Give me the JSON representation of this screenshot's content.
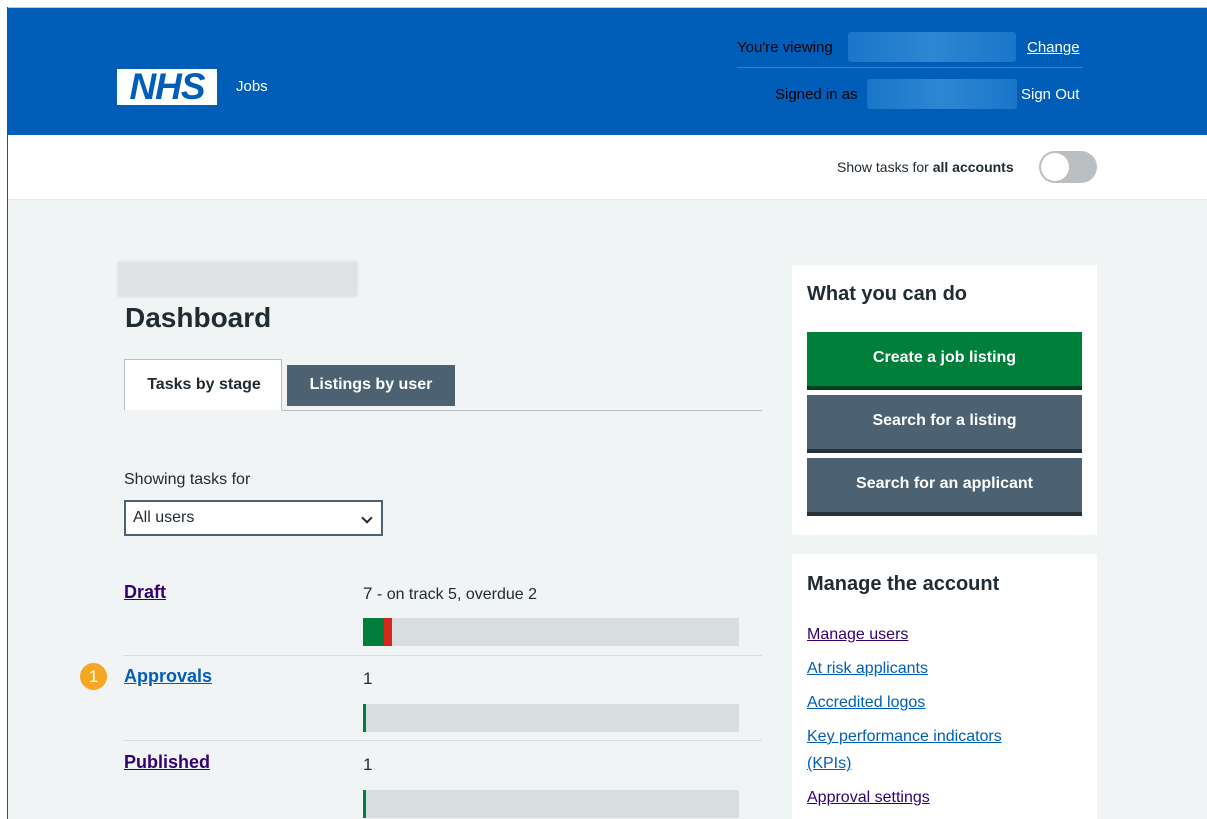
{
  "header": {
    "logo_text": "NHS",
    "service_name": "Jobs",
    "viewing_label": "You're viewing",
    "change_label": "Change",
    "signed_in_label": "Signed in as",
    "sign_out_label": "Sign Out",
    "brand_color": "#005eb8"
  },
  "toggle": {
    "label_prefix": "Show tasks for ",
    "label_bold": "all accounts",
    "state": "off"
  },
  "main": {
    "page_title": "Dashboard",
    "tabs": [
      {
        "label": "Tasks by stage",
        "active": true
      },
      {
        "label": "Listings by user",
        "active": false
      }
    ],
    "filter": {
      "label": "Showing tasks for",
      "selected": "All users"
    },
    "stages": [
      {
        "label": "Draft",
        "count": "7",
        "detail": " - on track 5, overdue 2",
        "on_track": 5,
        "overdue": 2,
        "total": 7
      },
      {
        "label": "Approvals",
        "count": "1",
        "detail": "",
        "on_track": 1,
        "overdue": 0,
        "total": 1
      },
      {
        "label": "Published",
        "count": "1",
        "detail": "",
        "on_track": 1,
        "overdue": 0,
        "total": 1
      }
    ],
    "step_badge": "1"
  },
  "sidebar": {
    "actions_title": "What you can do",
    "actions": [
      {
        "label": "Create a job listing",
        "style": "green"
      },
      {
        "label": "Search for a listing",
        "style": "grey"
      },
      {
        "label": "Search for an applicant",
        "style": "grey"
      }
    ],
    "manage_title": "Manage the account",
    "manage_links": [
      {
        "label": "Manage users"
      },
      {
        "label": "At risk applicants"
      },
      {
        "label": "Accredited logos"
      },
      {
        "label": "Key performance indicators"
      },
      {
        "label": "(KPIs)"
      },
      {
        "label": "Approval settings"
      }
    ]
  },
  "colors": {
    "on_track": "#007f3b",
    "overdue": "#d5281b",
    "bar_background": "#d8dde0",
    "visited_link": "#330072",
    "link": "#005eb8"
  }
}
